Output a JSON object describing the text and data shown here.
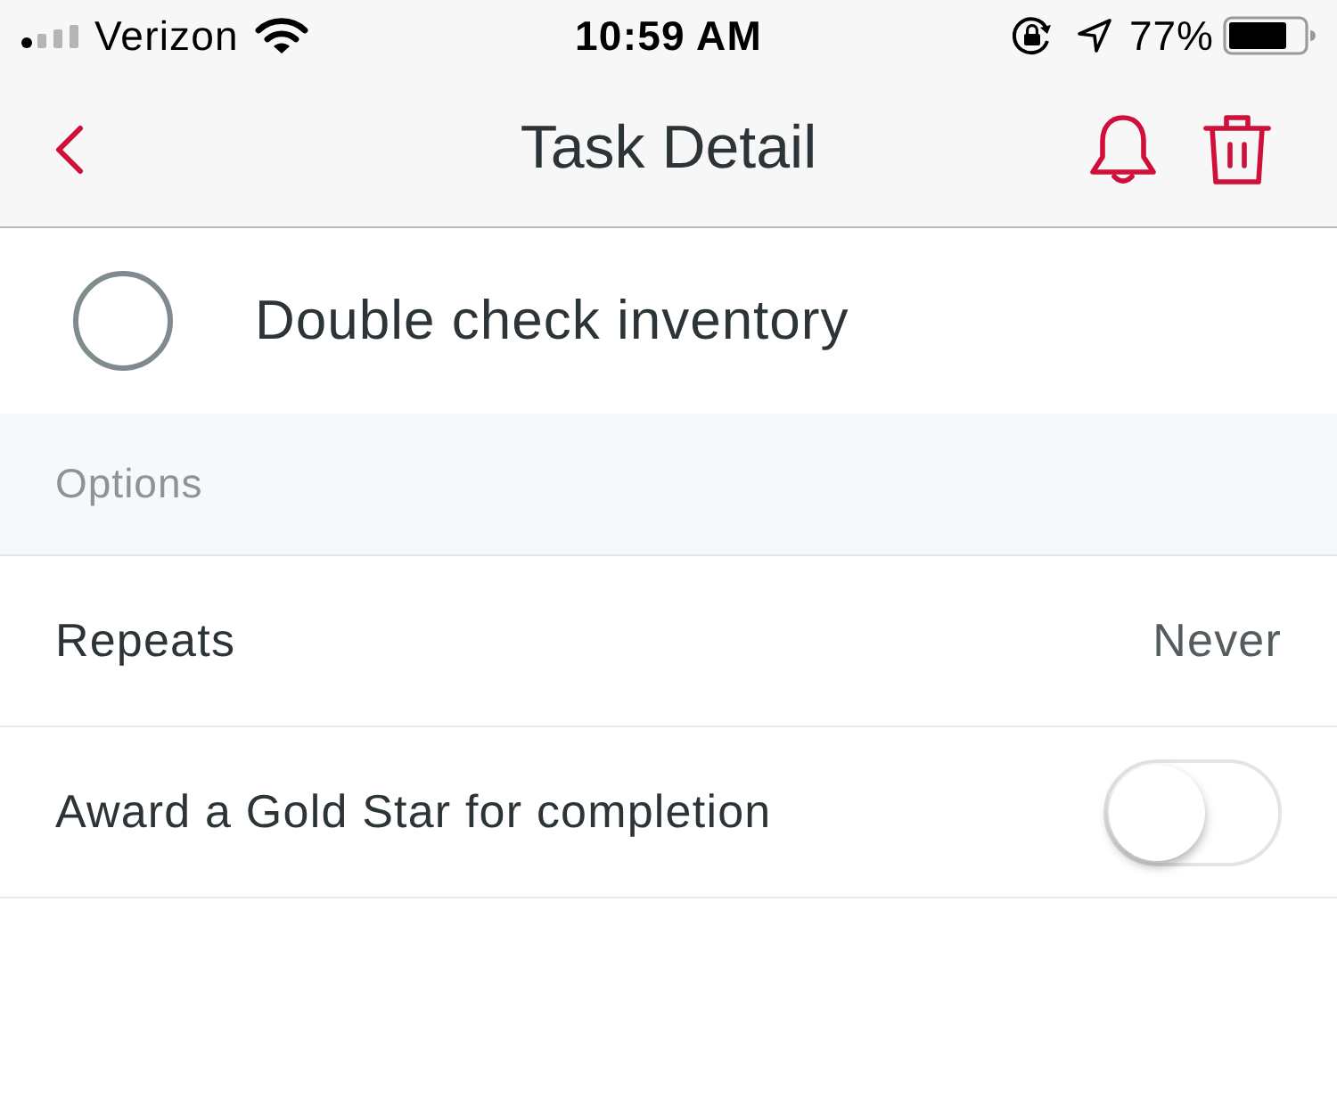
{
  "status_bar": {
    "carrier": "Verizon",
    "time": "10:59 AM",
    "battery": "77%"
  },
  "nav_bar": {
    "title": "Task Detail"
  },
  "task": {
    "title": "Double check inventory",
    "checked": false
  },
  "options_section": {
    "header": "Options",
    "rows": [
      {
        "kind": "value",
        "label": "Repeats",
        "value": "Never"
      },
      {
        "kind": "toggle",
        "label": "Award a Gold Star for completion",
        "on": false
      }
    ]
  }
}
